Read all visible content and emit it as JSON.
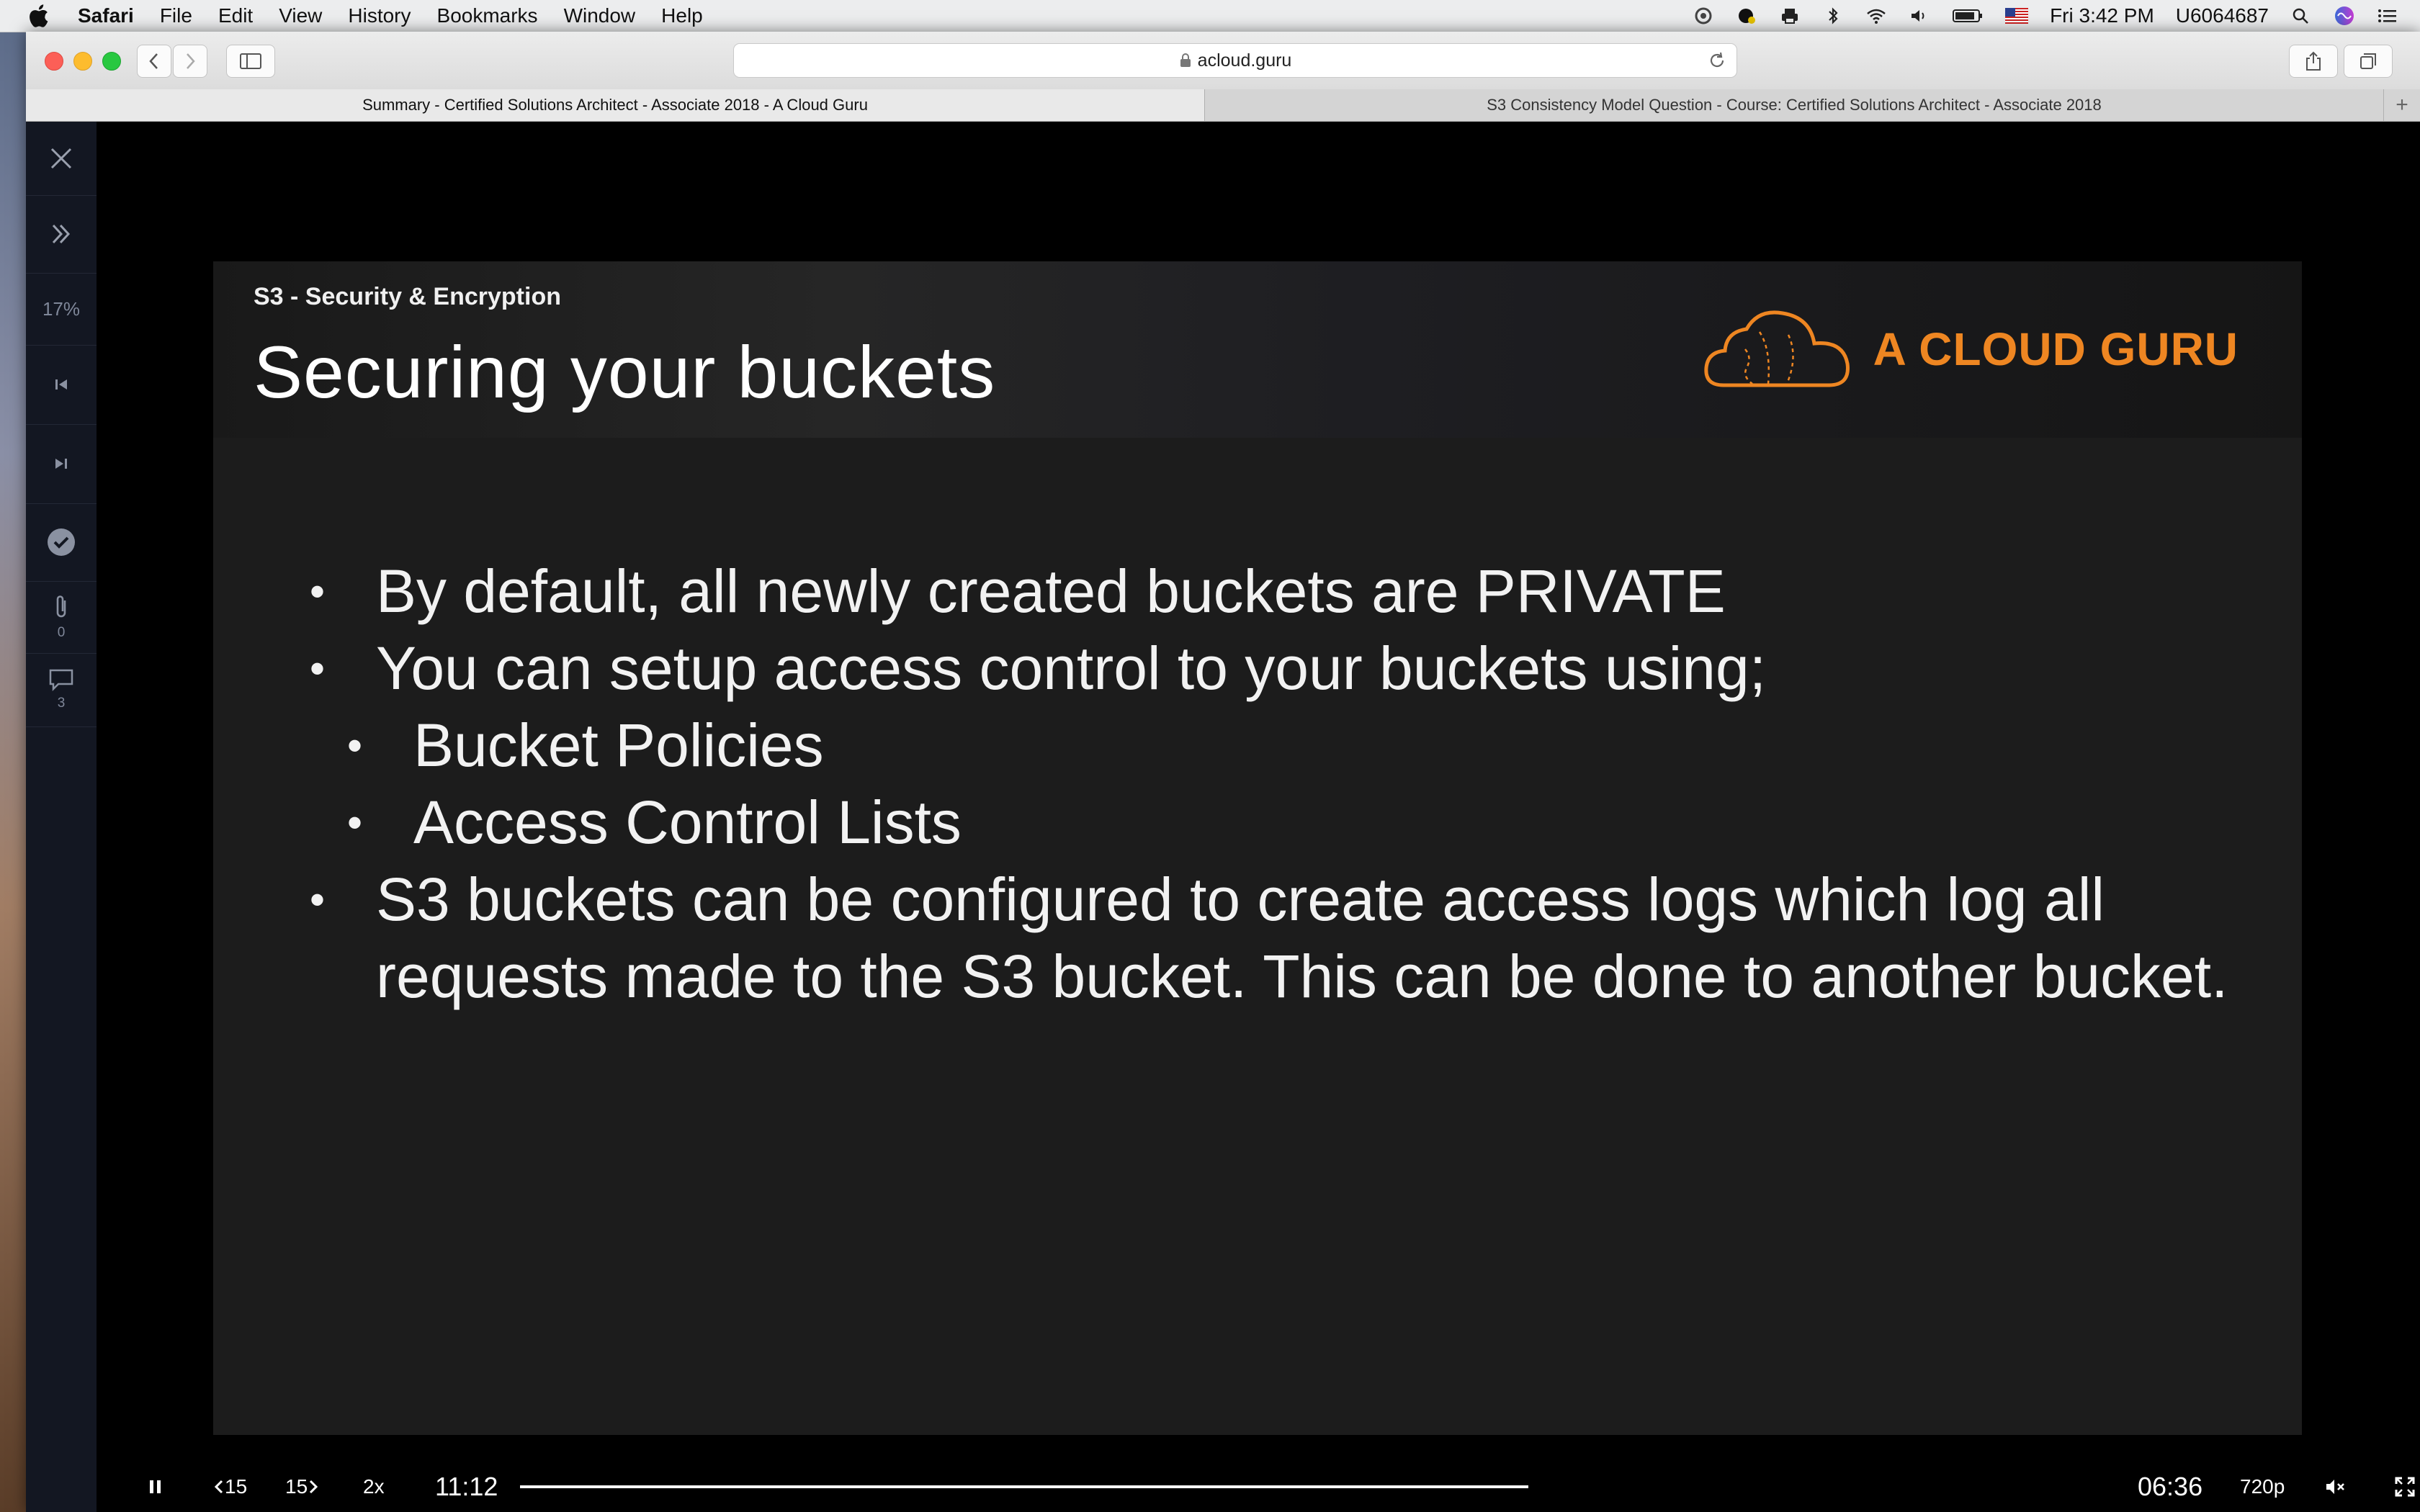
{
  "menubar": {
    "app_name": "Safari",
    "menus": [
      "File",
      "Edit",
      "View",
      "History",
      "Bookmarks",
      "Window",
      "Help"
    ],
    "clock": "Fri 3:42 PM",
    "user": "U6064687"
  },
  "browser": {
    "url": "acloud.guru",
    "tabs": [
      "Summary - Certified Solutions Architect - Associate 2018 - A Cloud Guru",
      "S3 Consistency Model Question - Course: Certified Solutions Architect - Associate 2018"
    ],
    "new_tab_label": "+"
  },
  "side_nav": {
    "progress": "17%",
    "attachments_count": "0",
    "comments_count": "3"
  },
  "slide": {
    "section": "S3 - Security & Encryption",
    "title": "Securing your buckets",
    "brand": "A CLOUD GURU",
    "bullets": [
      {
        "level": 1,
        "text": "By default, all newly created buckets are PRIVATE"
      },
      {
        "level": 1,
        "text": "You can setup access control to your buckets using;"
      },
      {
        "level": 2,
        "text": "Bucket Policies"
      },
      {
        "level": 2,
        "text": "Access Control Lists"
      },
      {
        "level": 1,
        "text": "S3 buckets can be configured to create access logs which log all requests made to the S3 bucket. This can be done to another bucket."
      }
    ],
    "bullet_symbol": "•"
  },
  "player": {
    "rewind_label": "15",
    "forward_label": "15",
    "speed": "2x",
    "elapsed": "11:12",
    "remaining": "06:36",
    "quality": "720p",
    "progress_fraction": 1.0
  },
  "colors": {
    "brand_orange": "#ee8622",
    "nav_bg": "#131722",
    "slide_bg": "#1c1c1c"
  },
  "icons": [
    "apple-icon",
    "close-icon",
    "expand-icon",
    "previous-icon",
    "next-icon",
    "complete-check-icon",
    "attachment-icon",
    "comment-icon",
    "pause-icon",
    "mute-icon",
    "fullscreen-icon"
  ]
}
